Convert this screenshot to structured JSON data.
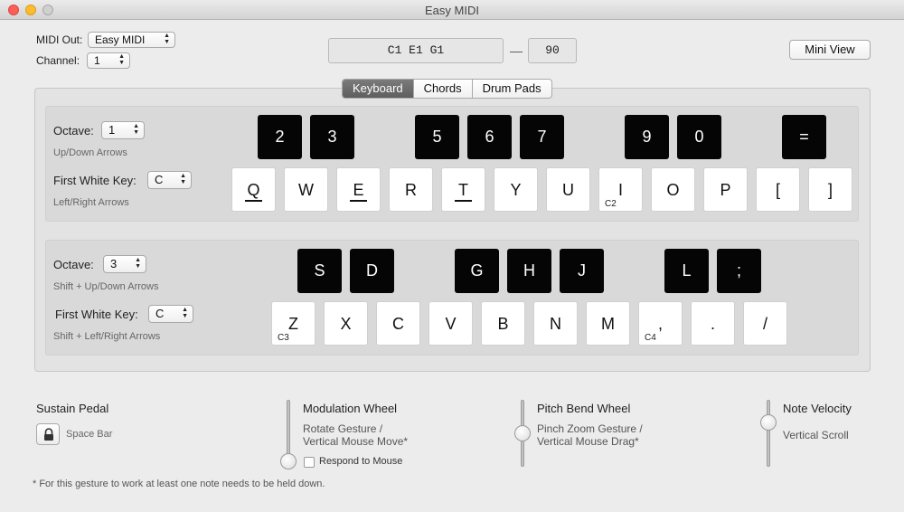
{
  "window": {
    "title": "Easy MIDI"
  },
  "header": {
    "midi_out_label": "MIDI Out:",
    "midi_out_value": "Easy MIDI",
    "channel_label": "Channel:",
    "channel_value": "1",
    "chord_display": "C1 E1 G1",
    "separator": "—",
    "velocity_display": "90",
    "mini_view_label": "Mini View"
  },
  "tabs": [
    {
      "label": "Keyboard",
      "active": true
    },
    {
      "label": "Chords",
      "active": false
    },
    {
      "label": "Drum Pads",
      "active": false
    }
  ],
  "row1": {
    "octave_label": "Octave:",
    "octave_value": "1",
    "octave_hint": "Up/Down Arrows",
    "first_white_label": "First White Key:",
    "first_white_value": "C",
    "first_white_hint": "Left/Right Arrows",
    "black_keys": [
      "2",
      "3",
      "5",
      "6",
      "7",
      "9",
      "0",
      "="
    ],
    "white_keys": [
      "Q",
      "W",
      "E",
      "R",
      "T",
      "Y",
      "U",
      "I",
      "O",
      "P",
      "[",
      "]"
    ],
    "note_labels": {
      "I": "C2"
    }
  },
  "row2": {
    "octave_label": "Octave:",
    "octave_value": "3",
    "octave_hint": "Shift + Up/Down Arrows",
    "first_white_label": "First White Key:",
    "first_white_value": "C",
    "first_white_hint": "Shift + Left/Right Arrows",
    "black_keys": [
      "S",
      "D",
      "G",
      "H",
      "J",
      "L",
      ";"
    ],
    "white_keys": [
      "Z",
      "X",
      "C",
      "V",
      "B",
      "N",
      "M",
      ",",
      ".",
      "/"
    ],
    "note_labels": {
      "Z": "C3",
      ",": "C4"
    }
  },
  "controls": {
    "sustain_title": "Sustain Pedal",
    "sustain_hint": "Space Bar",
    "modulation_title": "Modulation Wheel",
    "modulation_hint_1": "Rotate Gesture /",
    "modulation_hint_2": "Vertical Mouse Move*",
    "respond_label": "Respond to Mouse",
    "pitch_title": "Pitch Bend Wheel",
    "pitch_hint_1": "Pinch Zoom Gesture /",
    "pitch_hint_2": "Vertical Mouse Drag*",
    "velocity_title": "Note Velocity",
    "velocity_hint": "Vertical Scroll"
  },
  "footnote": "* For this gesture to work at least one note needs to be held down.",
  "icons": {
    "lock": "lock-icon",
    "popup_arrows": "updown-chevron-icon"
  }
}
